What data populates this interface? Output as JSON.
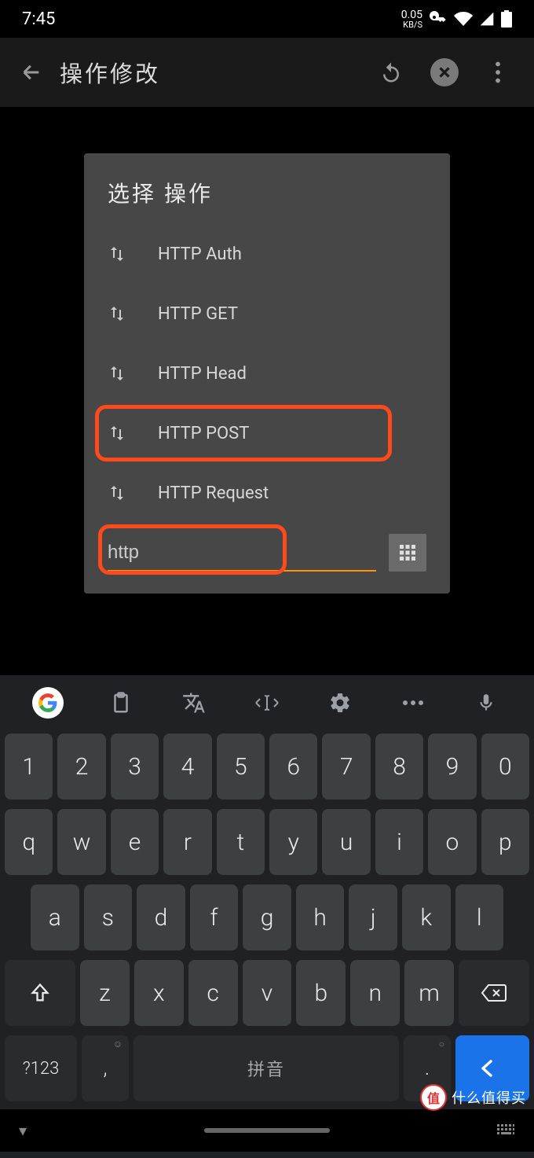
{
  "status": {
    "time": "7:45",
    "speed_num": "0.05",
    "speed_unit": "KB/S"
  },
  "appbar": {
    "title": "操作修改"
  },
  "dialog": {
    "title": "选择 操作",
    "options": [
      {
        "label": "HTTP Auth",
        "highlighted": false
      },
      {
        "label": "HTTP GET",
        "highlighted": false
      },
      {
        "label": "HTTP Head",
        "highlighted": false
      },
      {
        "label": "HTTP POST",
        "highlighted": true
      },
      {
        "label": "HTTP Request",
        "highlighted": false
      }
    ],
    "filter_value": "http"
  },
  "keyboard": {
    "row1": [
      "1",
      "2",
      "3",
      "4",
      "5",
      "6",
      "7",
      "8",
      "9",
      "0"
    ],
    "row2": [
      "q",
      "w",
      "e",
      "r",
      "t",
      "y",
      "u",
      "i",
      "o",
      "p"
    ],
    "row3": [
      "a",
      "s",
      "d",
      "f",
      "g",
      "h",
      "j",
      "k",
      "l"
    ],
    "row4": [
      "z",
      "x",
      "c",
      "v",
      "b",
      "n",
      "m"
    ],
    "sym": "?123",
    "comma": ",",
    "space": "拼音",
    "period": "."
  },
  "watermark": {
    "badge": "值",
    "text": "什么值得买"
  }
}
